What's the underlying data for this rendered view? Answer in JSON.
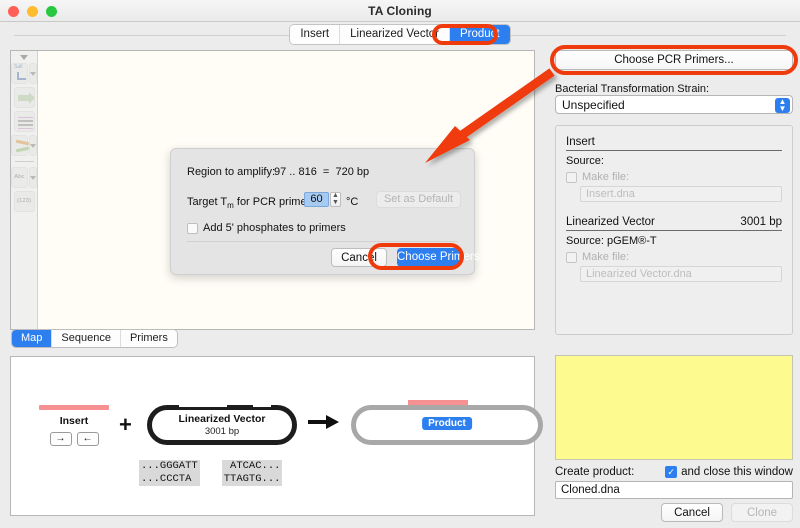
{
  "window": {
    "title": "TA Cloning"
  },
  "traffic_lights": [
    "close",
    "minimize",
    "zoom"
  ],
  "tabs": [
    {
      "label": "Insert",
      "active": false
    },
    {
      "label": "Linearized Vector",
      "active": false
    },
    {
      "label": "Product",
      "active": true
    }
  ],
  "subtabs": [
    {
      "label": "Map",
      "active": true
    },
    {
      "label": "Sequence",
      "active": false
    },
    {
      "label": "Primers",
      "active": false
    }
  ],
  "toolbar": {
    "sall_label": "SalI",
    "abc_label": "Abc",
    "numbers_label": "(123)"
  },
  "right_panel": {
    "pcr_button": "Choose PCR Primers...",
    "strain_label": "Bacterial Transformation Strain:",
    "strain_value": "Unspecified",
    "info": {
      "insert": {
        "title": "Insert",
        "source_label": "Source:",
        "make_file_label": "Make file:",
        "file_placeholder": "Insert.dna"
      },
      "vector": {
        "title": "Linearized Vector",
        "size": "3001 bp",
        "source_label": "Source:",
        "source_value": "pGEM®-T",
        "make_file_label": "Make file:",
        "file_placeholder": "Linearized Vector.dna"
      }
    },
    "create_label": "Create product:",
    "close_window_label": "and close this window",
    "close_window_checked": true,
    "product_filename": "Cloned.dna",
    "cancel_button": "Cancel",
    "clone_button": "Clone",
    "clone_disabled": true
  },
  "diagram": {
    "insert_label": "Insert",
    "arrow_fwd": "→",
    "arrow_rev": "←",
    "plus": "+",
    "vector_label": "Linearized Vector",
    "vector_bp": "3001 bp",
    "product_label": "Product",
    "seq_left_top": "...GGGATT",
    "seq_left_bottom": "...CCCTA",
    "seq_right_top": " ATCAC...",
    "seq_right_bottom": "TTAGTG..."
  },
  "dialog": {
    "region_label": "Region to amplify:",
    "region_value": "97 .. 816  =  720 bp",
    "tm_label_pre": "Target T",
    "tm_label_sub": "m",
    "tm_label_post": " for PCR primers:",
    "tm_value": "60",
    "tm_unit": "°C",
    "set_default_button": "Set as Default",
    "set_default_disabled": true,
    "phosphates_label": "Add 5' phosphates to primers",
    "phosphates_checked": false,
    "cancel_button": "Cancel",
    "choose_button": "Choose Primers"
  },
  "annotations": {
    "highlight_color": "#ef3b0c",
    "arrow_from": "Choose PCR Primers...",
    "arrow_to": "dialog"
  },
  "colors": {
    "accent_blue": "#2d7ff0",
    "annotation_red": "#ef3b0c",
    "insert_pink": "#f79191",
    "note_yellow": "#fdfb8f",
    "map_bg": "#fffdf6"
  }
}
